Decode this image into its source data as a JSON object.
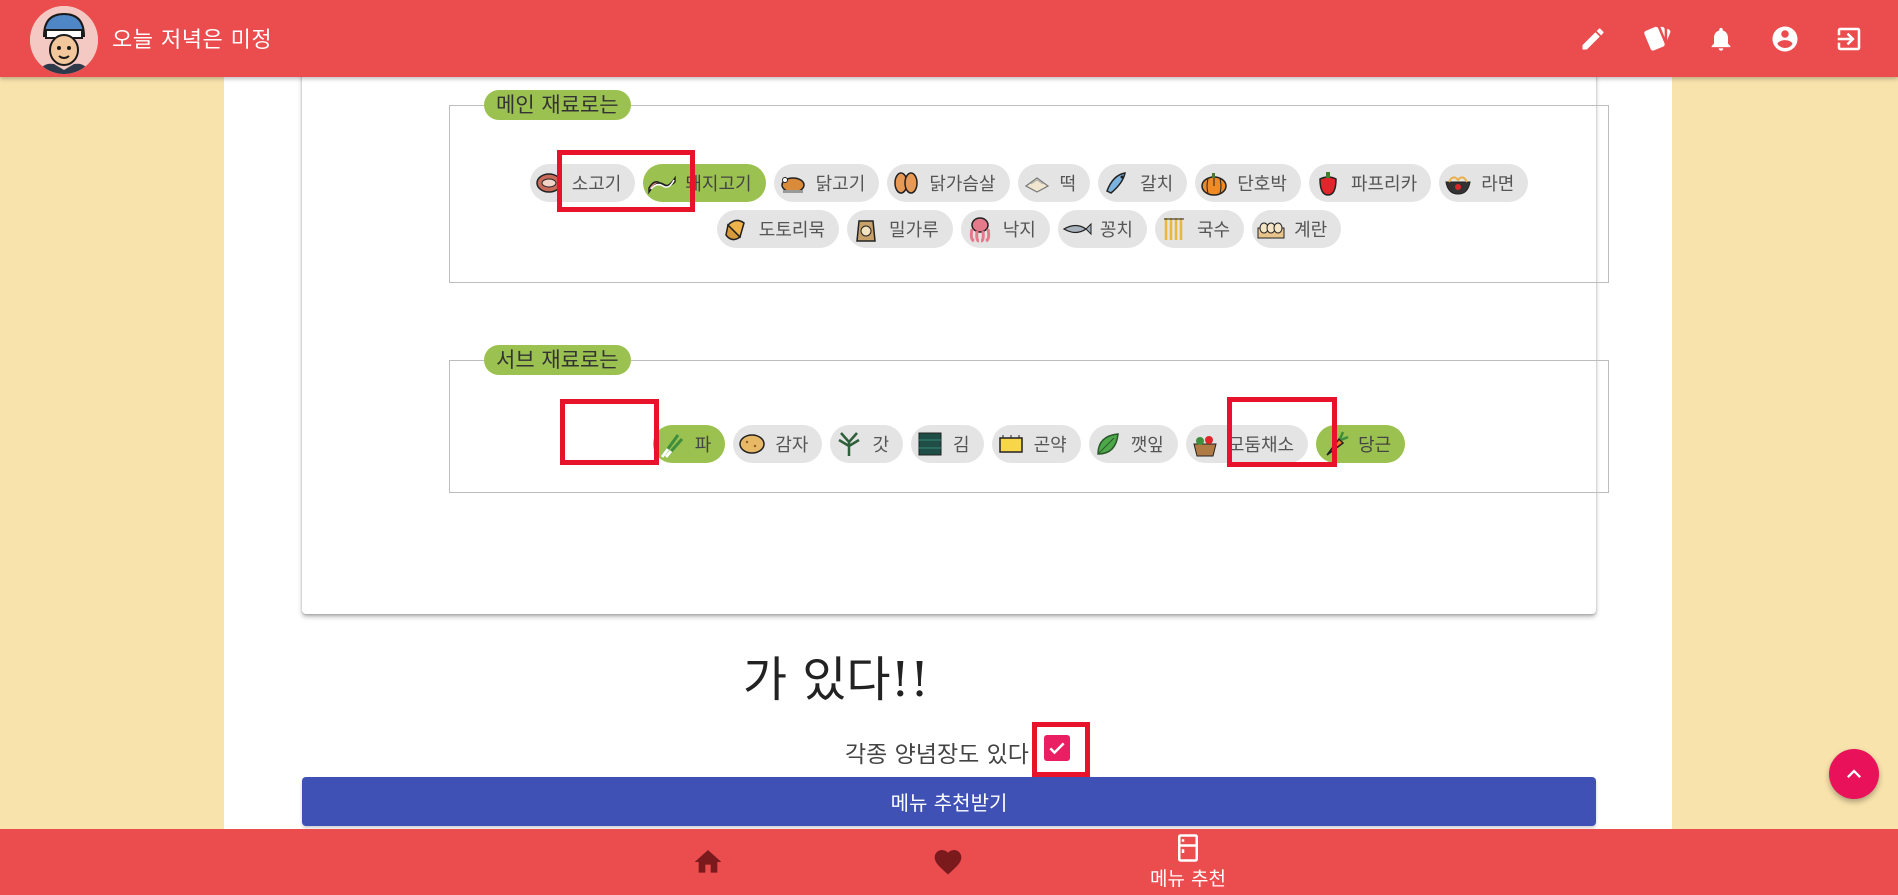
{
  "header": {
    "app_title": "오늘 저녁은 미정",
    "logo_icon": "chef-avatar-logo",
    "actions": [
      {
        "icon": "pencil-icon"
      },
      {
        "icon": "cards-icon"
      },
      {
        "icon": "bell-icon"
      },
      {
        "icon": "account-circle-icon"
      },
      {
        "icon": "logout-icon"
      }
    ]
  },
  "main_ingredients": {
    "legend": "메인 재료로는",
    "items": [
      {
        "label": "소고기",
        "icon": "steak-icon",
        "selected": false
      },
      {
        "label": "돼지고기",
        "icon": "bacon-icon",
        "selected": true
      },
      {
        "label": "닭고기",
        "icon": "roast-chicken-icon",
        "selected": false
      },
      {
        "label": "닭가슴살",
        "icon": "chicken-breast-icon",
        "selected": false
      },
      {
        "label": "떡",
        "icon": "rice-cake-icon",
        "selected": false
      },
      {
        "label": "갈치",
        "icon": "fish-icon",
        "selected": false
      },
      {
        "label": "단호박",
        "icon": "pumpkin-icon",
        "selected": false
      },
      {
        "label": "파프리카",
        "icon": "pepper-icon",
        "selected": false
      },
      {
        "label": "라면",
        "icon": "noodle-bowl-icon",
        "selected": false
      },
      {
        "label": "도토리묵",
        "icon": "acorn-icon",
        "selected": false
      },
      {
        "label": "밀가루",
        "icon": "flour-sack-icon",
        "selected": false
      },
      {
        "label": "낙지",
        "icon": "octopus-icon",
        "selected": false
      },
      {
        "label": "꽁치",
        "icon": "saury-icon",
        "selected": false
      },
      {
        "label": "국수",
        "icon": "noodles-icon",
        "selected": false
      },
      {
        "label": "계란",
        "icon": "eggs-icon",
        "selected": false
      }
    ]
  },
  "sub_ingredients": {
    "legend": "서브 재료로는",
    "items": [
      {
        "label": "파",
        "icon": "scallion-icon",
        "selected": true
      },
      {
        "label": "감자",
        "icon": "potato-icon",
        "selected": false
      },
      {
        "label": "갓",
        "icon": "mustard-greens-icon",
        "selected": false
      },
      {
        "label": "김",
        "icon": "seaweed-icon",
        "selected": false
      },
      {
        "label": "곤약",
        "icon": "konjac-icon",
        "selected": false
      },
      {
        "label": "깻잎",
        "icon": "perilla-leaf-icon",
        "selected": false
      },
      {
        "label": "모둠채소",
        "icon": "vegetable-basket-icon",
        "selected": false
      },
      {
        "label": "당근",
        "icon": "carrot-icon",
        "selected": true
      }
    ]
  },
  "statement": "가 있다!!",
  "seasoning": {
    "label": "각종 양념장도 있다!",
    "checked": true
  },
  "submit_label": "메뉴 추천받기",
  "bottom_nav": [
    {
      "icon": "home-icon",
      "label": ""
    },
    {
      "icon": "heart-icon",
      "label": ""
    },
    {
      "icon": "fridge-icon",
      "label": "메뉴 추천"
    }
  ],
  "colors": {
    "primary": "#EB4D4F",
    "page_background": "#F8E3AC",
    "chip_selected": "#9BC150",
    "chip_default": "#E4E4E4",
    "button": "#3F51B5",
    "accent": "#E91E63",
    "highlight_box": "#E8132A"
  }
}
